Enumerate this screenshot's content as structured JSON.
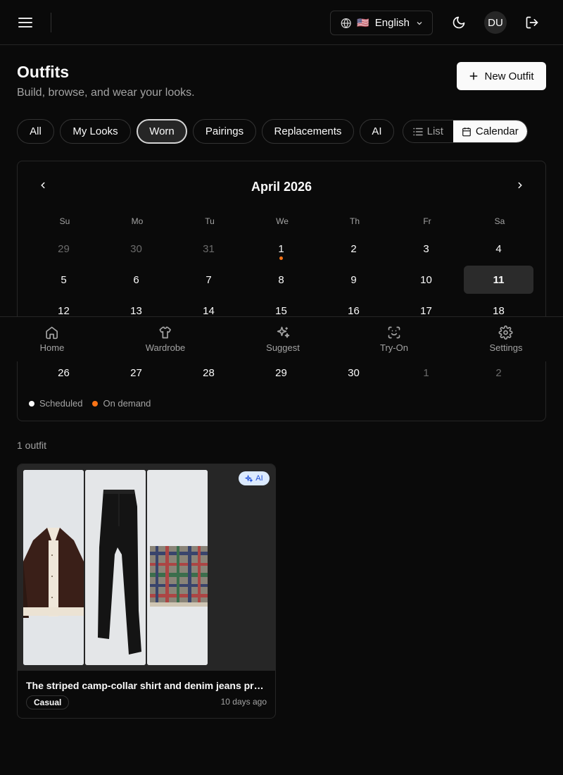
{
  "header": {
    "language": "English",
    "language_flag": "🇺🇸",
    "avatar_initials": "DU"
  },
  "page": {
    "title": "Outfits",
    "subtitle": "Build, browse, and wear your looks.",
    "new_button": "New Outfit"
  },
  "filters": [
    {
      "label": "All",
      "active": false
    },
    {
      "label": "My Looks",
      "active": false
    },
    {
      "label": "Worn",
      "active": true
    },
    {
      "label": "Pairings",
      "active": false
    },
    {
      "label": "Replacements",
      "active": false
    },
    {
      "label": "AI",
      "active": false
    }
  ],
  "view_toggle": {
    "list": "List",
    "calendar": "Calendar",
    "selected": "Calendar"
  },
  "calendar": {
    "month_label": "April 2026",
    "weekdays": [
      "Su",
      "Mo",
      "Tu",
      "We",
      "Th",
      "Fr",
      "Sa"
    ],
    "weeks": [
      [
        {
          "d": "29",
          "m": true
        },
        {
          "d": "30",
          "m": true
        },
        {
          "d": "31",
          "m": true
        },
        {
          "d": "1",
          "dot": true
        },
        {
          "d": "2"
        },
        {
          "d": "3"
        },
        {
          "d": "4"
        }
      ],
      [
        {
          "d": "5"
        },
        {
          "d": "6"
        },
        {
          "d": "7"
        },
        {
          "d": "8"
        },
        {
          "d": "9"
        },
        {
          "d": "10"
        },
        {
          "d": "11",
          "today": true
        }
      ],
      [
        {
          "d": "12"
        },
        {
          "d": "13"
        },
        {
          "d": "14"
        },
        {
          "d": "15"
        },
        {
          "d": "16"
        },
        {
          "d": "17"
        },
        {
          "d": "18"
        }
      ],
      [
        {
          "d": "26"
        },
        {
          "d": "27"
        },
        {
          "d": "28"
        },
        {
          "d": "29"
        },
        {
          "d": "30"
        },
        {
          "d": "1",
          "m": true
        },
        {
          "d": "2",
          "m": true
        }
      ]
    ],
    "legend": [
      {
        "label": "Scheduled",
        "color": "#fafafa"
      },
      {
        "label": "On demand",
        "color": "#f97316"
      }
    ]
  },
  "bottom_nav": [
    {
      "label": "Home",
      "icon": "home-icon"
    },
    {
      "label": "Wardrobe",
      "icon": "shirt-icon"
    },
    {
      "label": "Suggest",
      "icon": "sparkles-icon"
    },
    {
      "label": "Try-On",
      "icon": "scan-face-icon"
    },
    {
      "label": "Settings",
      "icon": "gear-icon"
    }
  ],
  "results": {
    "count_label": "1 outfit",
    "outfits": [
      {
        "title": "The striped camp-collar shirt and denim jeans pr…",
        "badge": "AI",
        "tag": "Casual",
        "time": "10 days ago"
      }
    ]
  }
}
